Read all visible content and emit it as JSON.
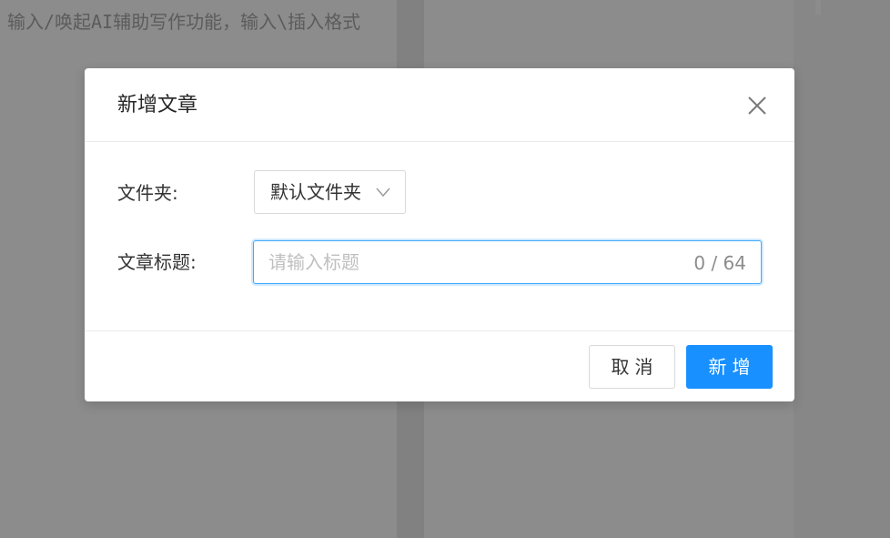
{
  "editor": {
    "placeholder": "输入/唤起AI辅助写作功能，输入\\插入格式"
  },
  "modal": {
    "title": "新增文章",
    "close_icon": "close-icon",
    "folder": {
      "label": "文件夹:",
      "selected": "默认文件夹",
      "chevron_icon": "chevron-down-icon"
    },
    "article_title": {
      "label": "文章标题:",
      "value": "",
      "placeholder": "请输入标题",
      "counter": "0 / 64"
    },
    "buttons": {
      "cancel": "取消",
      "submit": "新增"
    }
  },
  "colors": {
    "primary": "#1890ff",
    "mask": "rgba(0,0,0,0.45)"
  }
}
